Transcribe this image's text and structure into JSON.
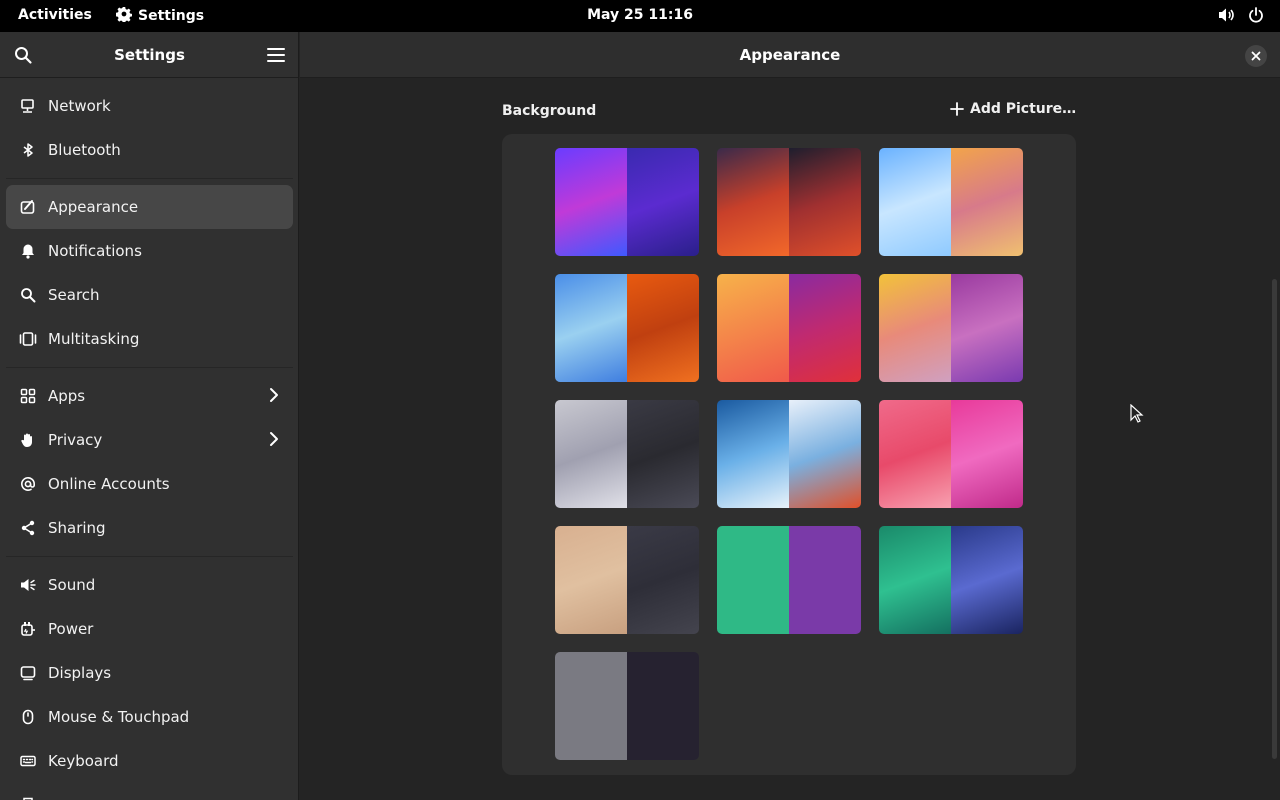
{
  "topbar": {
    "activities": "Activities",
    "app_name": "Settings",
    "clock": "May 25  11:16"
  },
  "sidebar": {
    "title": "Settings",
    "groups": [
      [
        {
          "label": "Network",
          "icon": "network-icon"
        },
        {
          "label": "Bluetooth",
          "icon": "bluetooth-icon"
        }
      ],
      [
        {
          "label": "Appearance",
          "icon": "appearance-icon",
          "active": true
        },
        {
          "label": "Notifications",
          "icon": "bell-icon"
        },
        {
          "label": "Search",
          "icon": "search-icon"
        },
        {
          "label": "Multitasking",
          "icon": "multitasking-icon"
        }
      ],
      [
        {
          "label": "Apps",
          "icon": "apps-icon",
          "chevron": true
        },
        {
          "label": "Privacy",
          "icon": "hand-icon",
          "chevron": true
        },
        {
          "label": "Online Accounts",
          "icon": "at-icon"
        },
        {
          "label": "Sharing",
          "icon": "share-icon"
        }
      ],
      [
        {
          "label": "Sound",
          "icon": "speaker-icon"
        },
        {
          "label": "Power",
          "icon": "power-plug-icon"
        },
        {
          "label": "Displays",
          "icon": "display-icon"
        },
        {
          "label": "Mouse & Touchpad",
          "icon": "mouse-icon"
        },
        {
          "label": "Keyboard",
          "icon": "keyboard-icon"
        },
        {
          "label": "",
          "icon": "printer-icon"
        }
      ]
    ]
  },
  "content": {
    "title": "Appearance",
    "background_label": "Background",
    "add_picture_label": "Add Picture…",
    "wallpapers": [
      {
        "name": "wallpaper-blobs",
        "light": [
          "#6a3cff",
          "#c03ad8",
          "#3f59ff"
        ],
        "dark": [
          "#3a2ab0",
          "#5b2bd0",
          "#2a1f8a"
        ]
      },
      {
        "name": "wallpaper-drool",
        "light": [
          "#3a2a4a",
          "#c8402a",
          "#f2682a"
        ],
        "dark": [
          "#1e1e2e",
          "#a03030",
          "#e0502a"
        ]
      },
      {
        "name": "wallpaper-vnc",
        "light": [
          "#6ab2ff",
          "#c8e6ff",
          "#8fcaff"
        ],
        "dark": [
          "#f2a44a",
          "#d77a8a",
          "#f0c070"
        ]
      },
      {
        "name": "wallpaper-drops",
        "light": [
          "#4a8ee8",
          "#9ad0f0",
          "#3f7ee0"
        ],
        "dark": [
          "#e85a10",
          "#c04010",
          "#f07020"
        ]
      },
      {
        "name": "wallpaper-gradient",
        "light": [
          "#f7b24a",
          "#f4864a",
          "#f05a4a"
        ],
        "dark": [
          "#8a2aa0",
          "#c02a70",
          "#e0303a"
        ]
      },
      {
        "name": "wallpaper-petals",
        "light": [
          "#f2c23a",
          "#e88a7a",
          "#d0a0c0"
        ],
        "dark": [
          "#9a3aa0",
          "#c870c0",
          "#7a3ab0"
        ]
      },
      {
        "name": "wallpaper-blocks",
        "light": [
          "#c8c8d0",
          "#a0a0b0",
          "#e0e0e8"
        ],
        "dark": [
          "#3a3a44",
          "#2a2a30",
          "#4a4a56"
        ]
      },
      {
        "name": "wallpaper-stripes",
        "light": [
          "#1a5aa0",
          "#6ab0e8",
          "#e8f2fa"
        ],
        "dark": [
          "#e8f0fa",
          "#7ab0e0",
          "#e0502a"
        ]
      },
      {
        "name": "wallpaper-pills",
        "light": [
          "#f06a8a",
          "#e84a6a",
          "#f8a0b0"
        ],
        "dark": [
          "#e83a9a",
          "#f06ac0",
          "#c02a8a"
        ]
      },
      {
        "name": "wallpaper-toys",
        "light": [
          "#d8b090",
          "#e0c0a0",
          "#c8a080"
        ],
        "dark": [
          "#3a3a46",
          "#2e2e38",
          "#44444e"
        ]
      },
      {
        "name": "wallpaper-solid-green-purple",
        "light": [
          "#2fb986",
          "#2fb986",
          "#2fb986"
        ],
        "dark": [
          "#7a3aa8",
          "#7a3aa8",
          "#7a3aa8"
        ]
      },
      {
        "name": "wallpaper-checks",
        "light": [
          "#1a8a6a",
          "#2fc090",
          "#147060"
        ],
        "dark": [
          "#2a3a8a",
          "#5a6ad0",
          "#1a2460"
        ]
      },
      {
        "name": "wallpaper-plain-gray",
        "light": [
          "#7a7a82",
          "#7a7a82",
          "#7a7a82"
        ],
        "dark": [
          "#262230",
          "#262230",
          "#262230"
        ]
      }
    ]
  }
}
